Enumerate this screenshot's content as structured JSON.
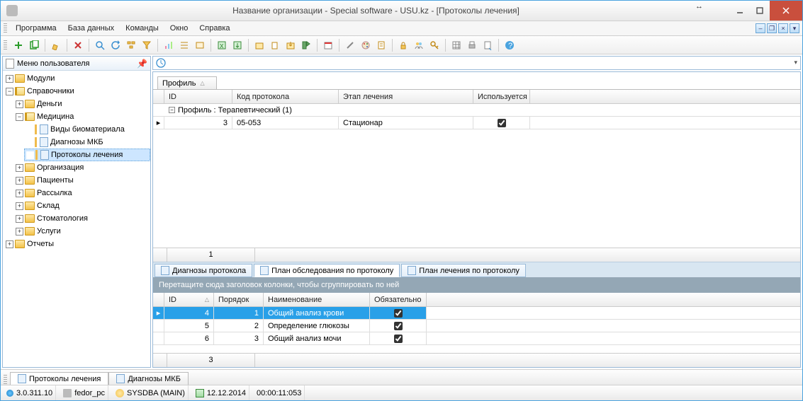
{
  "window": {
    "title": "Название организации - Special software - USU.kz - [Протоколы лечения]"
  },
  "menu": [
    "Программа",
    "База данных",
    "Команды",
    "Окно",
    "Справка"
  ],
  "sidebar": {
    "title": "Меню пользователя",
    "modules": "Модули",
    "refs": "Справочники",
    "money": "Деньги",
    "medicine": "Медицина",
    "biomat": "Виды биоматериала",
    "mkb": "Диагнозы МКБ",
    "proto": "Протоколы лечения",
    "org": "Организация",
    "patients": "Пациенты",
    "mail": "Рассылка",
    "stock": "Склад",
    "stoma": "Стоматология",
    "services": "Услуги",
    "reports": "Отчеты"
  },
  "groupTab": "Профиль",
  "grid1": {
    "headers": {
      "id": "ID",
      "code": "Код протокола",
      "stage": "Этап лечения",
      "used": "Используется"
    },
    "group": "Профиль : Терапевтический (1)",
    "row": {
      "id": "3",
      "code": "05-053",
      "stage": "Стационар"
    },
    "pager": "1"
  },
  "tabs": {
    "diag": "Диагнозы протокола",
    "plan_ex": "План обследования по протоколу",
    "plan_tr": "План лечения по протоколу"
  },
  "dragHint": "Перетащите сюда заголовок колонки, чтобы сгруппировать по ней",
  "grid2": {
    "headers": {
      "id": "ID",
      "order": "Порядок",
      "name": "Наименование",
      "req": "Обязательно"
    },
    "rows": [
      {
        "id": "4",
        "order": "1",
        "name": "Общий анализ крови"
      },
      {
        "id": "5",
        "order": "2",
        "name": "Определение глюкозы"
      },
      {
        "id": "6",
        "order": "3",
        "name": "Общий анализ мочи"
      }
    ],
    "pager": "3"
  },
  "docTabs": {
    "t1": "Протоколы лечения",
    "t2": "Диагнозы МКБ"
  },
  "status": {
    "ver": "3.0.311.10",
    "pc": "fedor_pc",
    "user": "SYSDBA (MAIN)",
    "date": "12.12.2014",
    "time": "00:00:11:053"
  }
}
